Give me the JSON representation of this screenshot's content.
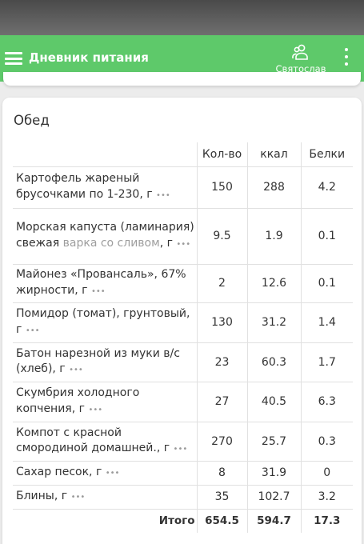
{
  "app_bar": {
    "title": "Дневник питания",
    "user_name": "Святослав",
    "menu_icon": "hamburger-menu-icon",
    "user_icon": "users-icon",
    "more_icon": "more-vertical-icon",
    "color": "#5ec96a"
  },
  "meal": {
    "title": "Обед",
    "columns": [
      "Кол-во",
      "ккал",
      "Белки"
    ],
    "rows": [
      {
        "name": "Картофель жареный брусочками по 1-230, г",
        "extra": "",
        "unit": "",
        "dots": "•••",
        "qty": "150",
        "kcal": "288",
        "protein": "4.2"
      },
      {
        "name": "Морская капуста (ламинария) свежая",
        "extra": "варка со сливом",
        "unit": ", г",
        "dots": "•••",
        "qty": "9.5",
        "kcal": "1.9",
        "protein": "0.1"
      },
      {
        "name": "Майонез «Провансаль», 67% жирности, г",
        "extra": "",
        "unit": "",
        "dots": "•••",
        "qty": "2",
        "kcal": "12.6",
        "protein": "0.1"
      },
      {
        "name": "Помидор (томат), грунтовый, г",
        "extra": "",
        "unit": "",
        "dots": "•••",
        "qty": "130",
        "kcal": "31.2",
        "protein": "1.4"
      },
      {
        "name": "Батон нарезной из муки в/с (хлеб), г",
        "extra": "",
        "unit": "",
        "dots": "•••",
        "qty": "23",
        "kcal": "60.3",
        "protein": "1.7"
      },
      {
        "name": "Скумбрия холодного копчения, г",
        "extra": "",
        "unit": "",
        "dots": "•••",
        "qty": "27",
        "kcal": "40.5",
        "protein": "6.3"
      },
      {
        "name": "Компот с красной смородиной домашней., г",
        "extra": "",
        "unit": "",
        "dots": "•••",
        "qty": "270",
        "kcal": "25.7",
        "protein": "0.3"
      },
      {
        "name": "Сахар песок, г",
        "extra": "",
        "unit": "",
        "dots": "•••",
        "qty": "8",
        "kcal": "31.9",
        "protein": "0"
      },
      {
        "name": "Блины, г",
        "extra": "",
        "unit": "",
        "dots": "•••",
        "qty": "35",
        "kcal": "102.7",
        "protein": "3.2"
      }
    ],
    "total": {
      "label": "Итого",
      "qty": "654.5",
      "kcal": "594.7",
      "protein": "17.3"
    }
  }
}
